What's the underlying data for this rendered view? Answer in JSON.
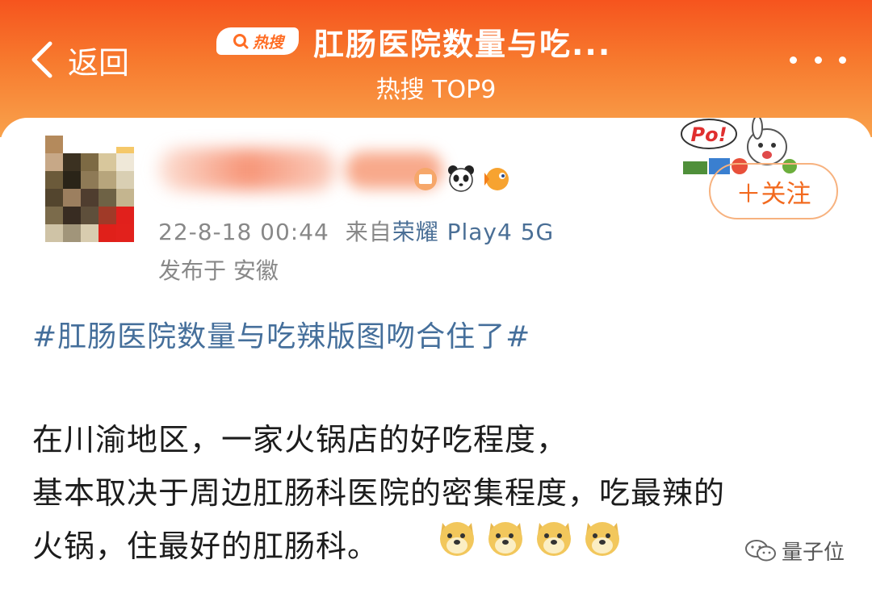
{
  "header": {
    "back_label": "返回",
    "hot_badge_label": "热搜",
    "title": "肛肠医院数量与吃...",
    "subtitle": "热搜 TOP9"
  },
  "post": {
    "timestamp": "22-8-18 00:44",
    "source_prefix": "来自",
    "device": "荣耀 Play4 5G",
    "location": "发布于 安徽",
    "follow_label": "＋关注",
    "sticker_text": "Po!",
    "hashtag": "#肛肠医院数量与吃辣版图吻合住了#",
    "lines": [
      "在川渝地区，一家火锅店的好吃程度，",
      "基本取决于周边肛肠科医院的密集程度，吃最辣的",
      "火锅，住最好的肛肠科。"
    ],
    "emoji_count": 4
  },
  "watermark": "量子位",
  "colors": {
    "header_top": "#f6541e",
    "header_bottom": "#f9a24c",
    "link": "#456f9b",
    "follow": "#f26a1f"
  }
}
